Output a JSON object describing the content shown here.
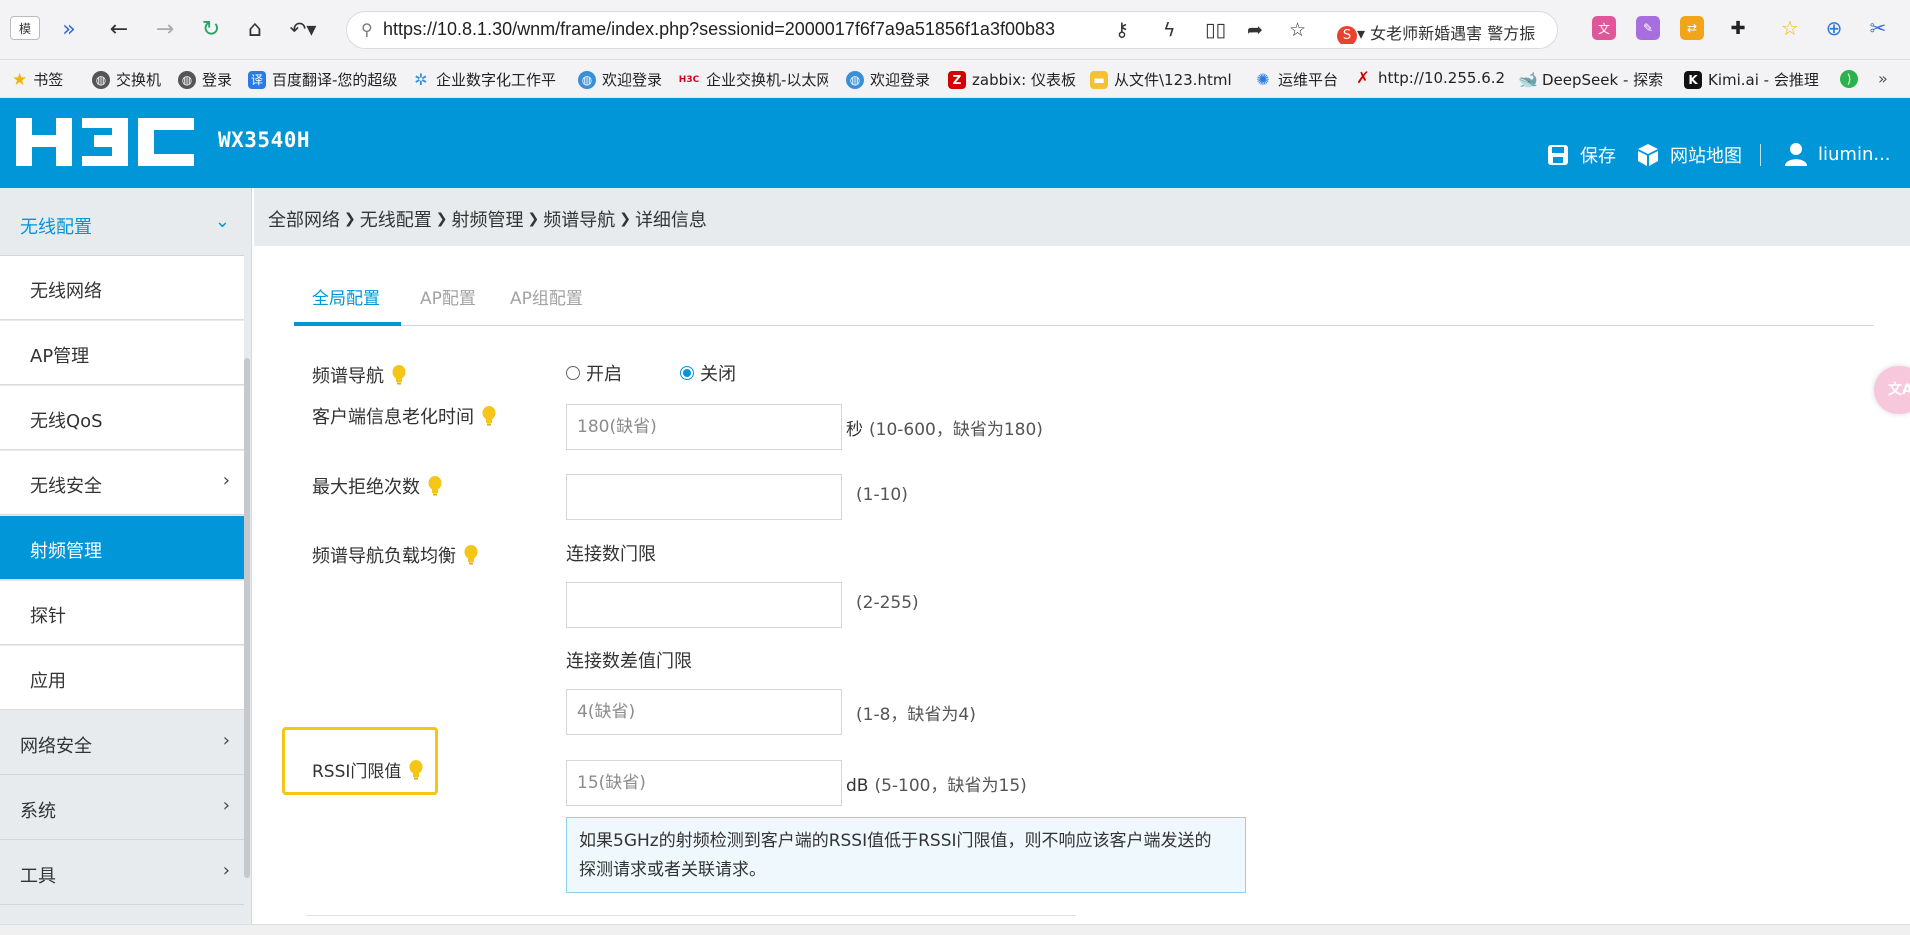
{
  "browser": {
    "url": "https://10.8.1.30/wnm/frame/index.php?sessionid=2000017f6f7a9a51856f1a3f00b83",
    "tab_label": "模",
    "news_text": "女老师新婚遇害 警方振",
    "bookmarks": [
      {
        "label": "书签",
        "icon": "star-icon",
        "color": "#f4b400"
      },
      {
        "label": "交换机",
        "icon": "globe-icon",
        "color": "#444444"
      },
      {
        "label": "登录",
        "icon": "globe-icon",
        "color": "#444444"
      },
      {
        "label": "百度翻译-您的超级",
        "icon": "translate-icon",
        "color": "#2c7be5"
      },
      {
        "label": "企业数字化工作平",
        "icon": "network-icon",
        "color": "#3a8fd9"
      },
      {
        "label": "欢迎登录",
        "icon": "globe-icon",
        "color": "#3a8fd9"
      },
      {
        "label": "企业交换机-以太网",
        "icon": "h3c-icon",
        "color": "#d0021b"
      },
      {
        "label": "欢迎登录",
        "icon": "globe-icon",
        "color": "#3a8fd9"
      },
      {
        "label": "zabbix: 仪表板",
        "icon": "zabbix-icon",
        "color": "#d40000"
      },
      {
        "label": "从文件\\123.html",
        "icon": "folder-icon",
        "color": "#f2c230"
      },
      {
        "label": "运维平台",
        "icon": "loading-icon",
        "color": "#2c7be5"
      },
      {
        "label": "http://10.255.6.2",
        "icon": "x-icon",
        "color": "#d40000"
      },
      {
        "label": "DeepSeek - 探索",
        "icon": "deepseek-icon",
        "color": "#4d6bfe"
      },
      {
        "label": "Kimi.ai - 会推理",
        "icon": "kimi-icon",
        "color": "#111111"
      }
    ]
  },
  "header": {
    "logo_text": "H3C",
    "model": "WX3540H",
    "save_label": "保存",
    "sitemap_label": "网站地图",
    "user_label": "liumin..."
  },
  "sidebar": {
    "group_wireless": "无线配置",
    "items": [
      {
        "label": "无线网络"
      },
      {
        "label": "AP管理"
      },
      {
        "label": "无线QoS"
      },
      {
        "label": "无线安全"
      },
      {
        "label": "射频管理"
      },
      {
        "label": "探针"
      },
      {
        "label": "应用"
      }
    ],
    "group_network_security": "网络安全",
    "group_system": "系统",
    "group_tools": "工具"
  },
  "breadcrumb": [
    "全部网络",
    "无线配置",
    "射频管理",
    "频谱导航",
    "详细信息"
  ],
  "tabs": [
    "全局配置",
    "AP配置",
    "AP组配置"
  ],
  "form": {
    "spectrum_nav": {
      "label": "频谱导航",
      "option_on": "开启",
      "option_off": "关闭",
      "selected": "关闭"
    },
    "client_aging": {
      "label": "客户端信息老化时间",
      "placeholder": "180(缺省)",
      "unit": "秒",
      "hint": "(10-600，缺省为180)"
    },
    "max_reject": {
      "label": "最大拒绝次数",
      "placeholder": "",
      "hint": "(1-10)"
    },
    "load_balance": {
      "label": "频谱导航负载均衡",
      "conn_threshold_label": "连接数门限",
      "conn_threshold_placeholder": "",
      "conn_threshold_hint": "(2-255)",
      "conn_diff_label": "连接数差值门限",
      "conn_diff_placeholder": "4(缺省)",
      "conn_diff_hint": "(1-8，缺省为4)"
    },
    "rssi": {
      "label": "RSSI门限值",
      "placeholder": "15(缺省)",
      "unit": "dB",
      "hint": "(5-100，缺省为15)",
      "note": "如果5GHz的射频检测到客户端的RSSI值低于RSSI门限值，则不响应该客户端发送的 探测请求或者关联请求。"
    }
  },
  "colors": {
    "brand": "#0096d8",
    "highlight": "#f5c518",
    "bulb": "#f5c518"
  }
}
